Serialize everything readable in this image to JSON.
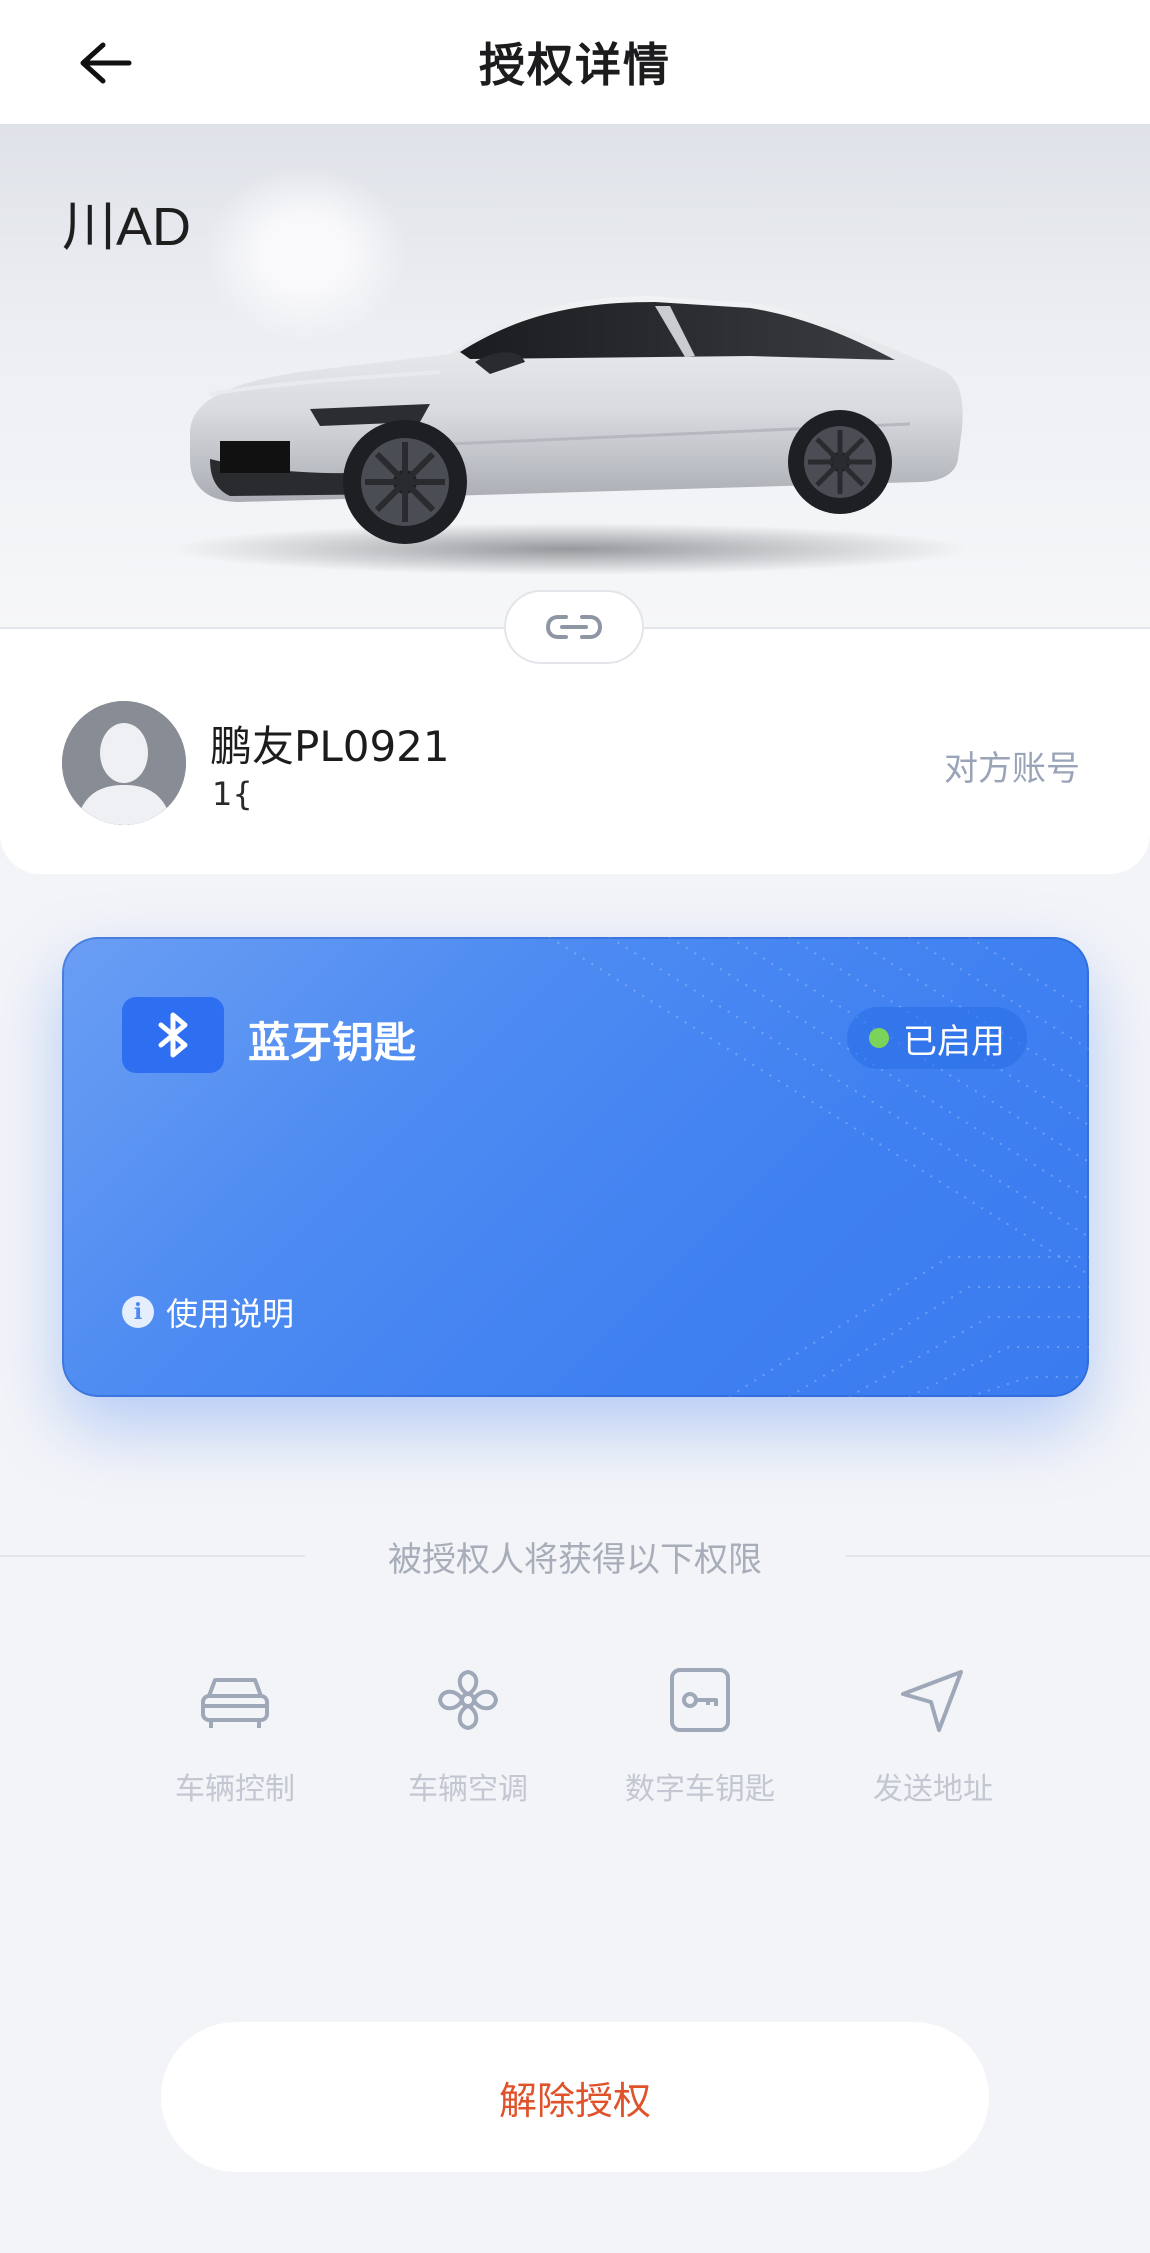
{
  "header": {
    "title": "授权详情",
    "back_icon": "arrow-left-icon"
  },
  "vehicle": {
    "plate": "川AD"
  },
  "user": {
    "name": "鹏友PL0921",
    "phone": "1{",
    "account_label": "对方账号"
  },
  "bluetooth_key": {
    "title": "蓝牙钥匙",
    "status": "已启用",
    "usage_link": "使用说明",
    "accent": "#3e7ff1",
    "status_color": "#7cd35a"
  },
  "permissions": {
    "heading": "被授权人将获得以下权限",
    "items": [
      {
        "label": "车辆控制",
        "icon": "car-icon"
      },
      {
        "label": "车辆空调",
        "icon": "fan-icon"
      },
      {
        "label": "数字车钥匙",
        "icon": "key-card-icon"
      },
      {
        "label": "发送地址",
        "icon": "send-location-icon"
      }
    ]
  },
  "actions": {
    "revoke_label": "解除授权",
    "revoke_color": "#e0522a"
  }
}
